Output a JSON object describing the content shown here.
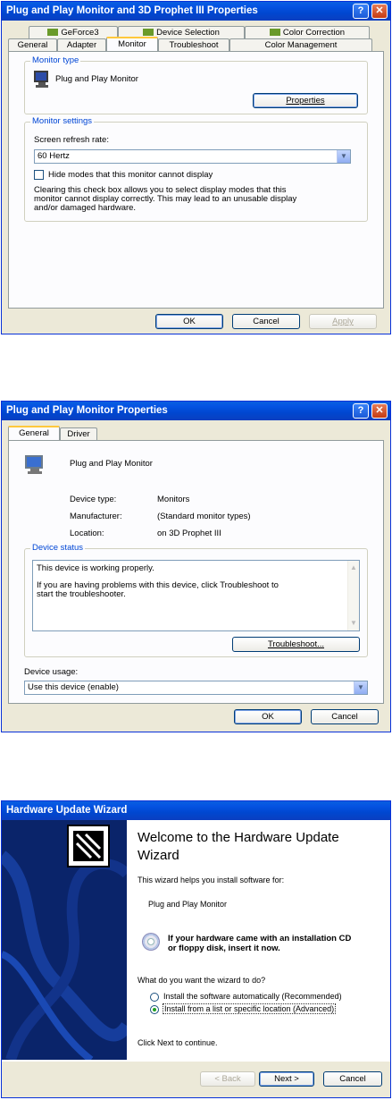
{
  "window1": {
    "title": "Plug and Play Monitor and 3D Prophet III Properties",
    "help": "?",
    "close": "✕",
    "tabs_row1": [
      "GeForce3",
      "Device Selection",
      "Color Correction"
    ],
    "tabs_row2": [
      "General",
      "Adapter",
      "Monitor",
      "Troubleshoot",
      "Color Management"
    ],
    "monitor_type_label": "Monitor type",
    "monitor_name": "Plug and Play Monitor",
    "properties_button": "Properties",
    "monitor_settings_label": "Monitor settings",
    "refresh_label": "Screen refresh rate:",
    "refresh_value": "60 Hertz",
    "hide_modes_label": "Hide modes that this monitor cannot display",
    "hide_modes_description_1": "Clearing this check box allows you to select display modes that this",
    "hide_modes_description_2": "monitor cannot display correctly. This may lead to an unusable display",
    "hide_modes_description_3": "and/or damaged hardware.",
    "ok": "OK",
    "cancel": "Cancel",
    "apply": "Apply"
  },
  "window2": {
    "title": "Plug and Play Monitor Properties",
    "help": "?",
    "close": "✕",
    "tabs": [
      "General",
      "Driver"
    ],
    "device_name": "Plug and Play Monitor",
    "device_type_label": "Device type:",
    "device_type_value": "Monitors",
    "manufacturer_label": "Manufacturer:",
    "manufacturer_value": "(Standard monitor types)",
    "location_label": "Location:",
    "location_value": "on 3D Prophet III",
    "device_status_label": "Device status",
    "status_line_1": "This device is working properly.",
    "status_line_2": "If you are having problems with this device, click Troubleshoot to",
    "status_line_3": "start the troubleshooter.",
    "troubleshoot_button": "Troubleshoot...",
    "device_usage_label": "Device usage:",
    "device_usage_value": "Use this device (enable)",
    "ok": "OK",
    "cancel": "Cancel"
  },
  "window3": {
    "title": "Hardware Update Wizard",
    "heading_1": "Welcome to the Hardware Update",
    "heading_2": "Wizard",
    "intro": "This wizard helps you install software for:",
    "device": "Plug and Play Monitor",
    "cd_line_1": "If your hardware came with an installation CD",
    "cd_line_2": "or floppy disk, insert it now.",
    "question": "What do you want the wizard to do?",
    "option_auto": "Install the software automatically (Recommended)",
    "option_list": "Install from a list or specific location (Advanced)",
    "selected_option": "option_list",
    "continue_text": "Click Next to continue.",
    "back": "< Back",
    "next": "Next >",
    "cancel": "Cancel"
  },
  "colors": {
    "title_blue": "#0054e3",
    "group_label_blue": "#0046d5",
    "tab_highlight": "#ffc83c",
    "wizard_side": "#0a246a"
  }
}
